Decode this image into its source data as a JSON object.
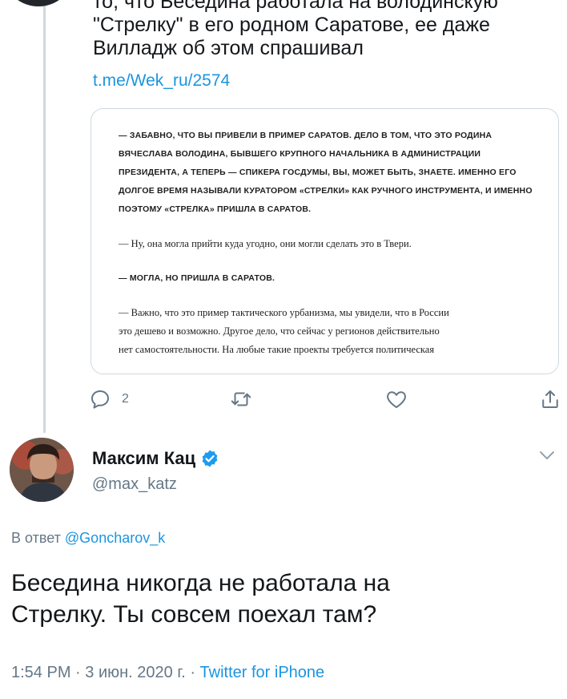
{
  "parent_tweet": {
    "text_lines": [
      "то, что Беседина работала на володинскую",
      "\"Стрелку\" в его родном Саратове, ее даже",
      "Вилладж об этом спрашивал"
    ],
    "link": "t.me/Wek_ru/2574",
    "quote": {
      "question_1": "— Забавно, что вы привели в пример Саратов. Дело в том, что это родина Вячеслава Володина, бывшего крупного начальника в администрации президента, а теперь — спикера Госдумы, вы, может быть, знаете. Именно его долгое время называли куратором «Стрелки» как ручного инструмента, и именно поэтому «Стрелка» пришла в Саратов.",
      "answer_1": "— Ну, она могла прийти куда угодно, они могли сделать это в Твери.",
      "question_2": "— Могла, но пришла в Саратов.",
      "answer_2_lines": [
        "— Важно, что это пример тактического урбанизма, мы увидели, что в России",
        "это дешево и возможно. Другое дело, что сейчас у регионов действительно",
        "нет самостоятельности. На любые такие проекты требуется политическая"
      ]
    },
    "actions": {
      "reply_count": "2",
      "reply_icon": "reply-icon",
      "retweet_icon": "retweet-icon",
      "like_icon": "heart-icon",
      "share_icon": "share-icon"
    }
  },
  "reply_tweet": {
    "author": {
      "name": "Максим Кац",
      "handle": "@max_katz",
      "verified": true
    },
    "reply_prefix": "В ответ",
    "reply_mention": "@Goncharov_k",
    "text_lines": [
      "Беседина никогда не работала на",
      "Стрелку. Ты совсем поехал там?"
    ],
    "time": "1:54 PM",
    "separator": "·",
    "date": "3 июн. 2020 г.",
    "source": "Twitter for iPhone"
  },
  "colors": {
    "link": "#1b95e0",
    "secondary_text": "#657786",
    "primary_text": "#14171a",
    "border": "#cfd9de"
  }
}
